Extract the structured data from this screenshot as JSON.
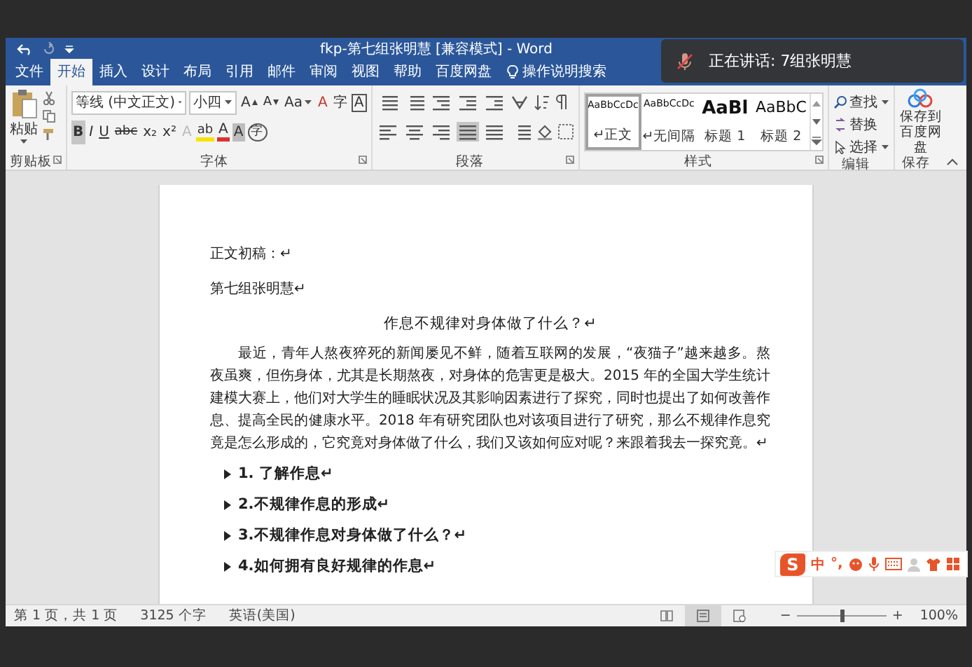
{
  "window": {
    "title": "fkp-第七组张明慧 [兼容模式] - Word"
  },
  "tabs": [
    {
      "label": "文件",
      "selected": false
    },
    {
      "label": "开始",
      "selected": true
    },
    {
      "label": "插入",
      "selected": false
    },
    {
      "label": "设计",
      "selected": false
    },
    {
      "label": "布局",
      "selected": false
    },
    {
      "label": "引用",
      "selected": false
    },
    {
      "label": "邮件",
      "selected": false
    },
    {
      "label": "审阅",
      "selected": false
    },
    {
      "label": "视图",
      "selected": false
    },
    {
      "label": "帮助",
      "selected": false
    },
    {
      "label": "百度网盘",
      "selected": false
    }
  ],
  "tell_me": {
    "placeholder": "操作说明搜索"
  },
  "ribbon": {
    "clipboard": {
      "paste": "粘贴",
      "label": "剪贴板"
    },
    "font": {
      "name": "等线 (中文正文)",
      "size": "小四",
      "label": "字体",
      "row1_buttons": [
        {
          "kind": "grow",
          "label": "A"
        },
        {
          "kind": "shrink",
          "label": "A"
        },
        {
          "kind": "case",
          "label": "Aa"
        },
        {
          "kind": "clear",
          "label": "A"
        },
        {
          "kind": "phonetic",
          "label": "字"
        },
        {
          "kind": "border",
          "label": "A"
        }
      ],
      "format_buttons": [
        {
          "label": "B",
          "on": true
        },
        {
          "label": "I",
          "on": false
        },
        {
          "label": "U",
          "on": false
        },
        {
          "label": "abc",
          "on": false
        },
        {
          "label": "x₂",
          "on": false
        },
        {
          "label": "x²",
          "on": false
        }
      ],
      "effect_buttons": [
        {
          "kind": "effects",
          "label": "A"
        },
        {
          "kind": "highlight",
          "label": "ab"
        },
        {
          "kind": "color",
          "label": "A"
        },
        {
          "kind": "shading",
          "label": "A"
        },
        {
          "kind": "enclose",
          "label": "字"
        }
      ]
    },
    "paragraph": {
      "label": "段落",
      "align_buttons": [
        {
          "kind": "left",
          "selected": false
        },
        {
          "kind": "center",
          "selected": false
        },
        {
          "kind": "right",
          "selected": false
        },
        {
          "kind": "justify",
          "selected": true
        },
        {
          "kind": "distributed",
          "selected": false
        }
      ]
    },
    "styles": {
      "label": "样式",
      "items": [
        {
          "kind": "body",
          "preview": "AaBbCcDc",
          "label": "↵正文",
          "selected": true
        },
        {
          "kind": "body",
          "preview": "AaBbCcDc",
          "label": "↵无间隔",
          "selected": false
        },
        {
          "kind": "h1",
          "preview": "AaBl",
          "label": "标题 1",
          "selected": false
        },
        {
          "kind": "h2",
          "preview": "AaBbC",
          "label": "标题 2",
          "selected": false
        }
      ]
    },
    "editing": {
      "label": "编辑",
      "find": "查找",
      "replace": "替换",
      "select": "选择"
    },
    "save": {
      "lines": [
        "保存到",
        "百度网盘"
      ],
      "label": "保存"
    }
  },
  "document": {
    "paragraphs": [
      {
        "kind": "plain",
        "text": "正文初稿：↵"
      },
      {
        "kind": "plain",
        "text": "第七组张明慧↵"
      },
      {
        "kind": "title",
        "text": "作息不规律对身体做了什么？↵"
      },
      {
        "kind": "body",
        "text": "最近，青年人熬夜猝死的新闻屡见不鲜，随着互联网的发展，“夜猫子”越来越多。熬夜虽爽，但伤身体，尤其是长期熬夜，对身体的危害更是极大。2015 年的全国大学生统计建模大赛上，他们对大学生的睡眠状况及其影响因素进行了探究，同时也提出了如何改善作息、提高全民的健康水平。2018 年有研究团队也对该项目进行了研究，那么不规律作息究竟是怎么形成的，它究竟对身体做了什么，我们又该如何应对呢？来跟着我去一探究竟。↵"
      },
      {
        "kind": "heading",
        "text": "1.  了解作息↵"
      },
      {
        "kind": "heading",
        "text": "2.不规律作息的形成↵"
      },
      {
        "kind": "heading",
        "text": "3.不规律作息对身体做了什么？↵"
      },
      {
        "kind": "heading",
        "text": "4.如何拥有良好规律的作息↵"
      }
    ]
  },
  "status_bar": {
    "page": "第 1 页，共 1 页",
    "words": "3125 个字",
    "language": "英语(美国)",
    "views": [
      {
        "kind": "read",
        "selected": false
      },
      {
        "kind": "print",
        "selected": true
      },
      {
        "kind": "web",
        "selected": false
      }
    ],
    "zoom": {
      "minus": "−",
      "plus": "+",
      "level": 0.5,
      "percent": "100%"
    }
  },
  "speaking": {
    "text": "正在讲话: 7组张明慧"
  },
  "ime_bar": {
    "logo": "S",
    "mode": "中",
    "punct": "°,"
  }
}
